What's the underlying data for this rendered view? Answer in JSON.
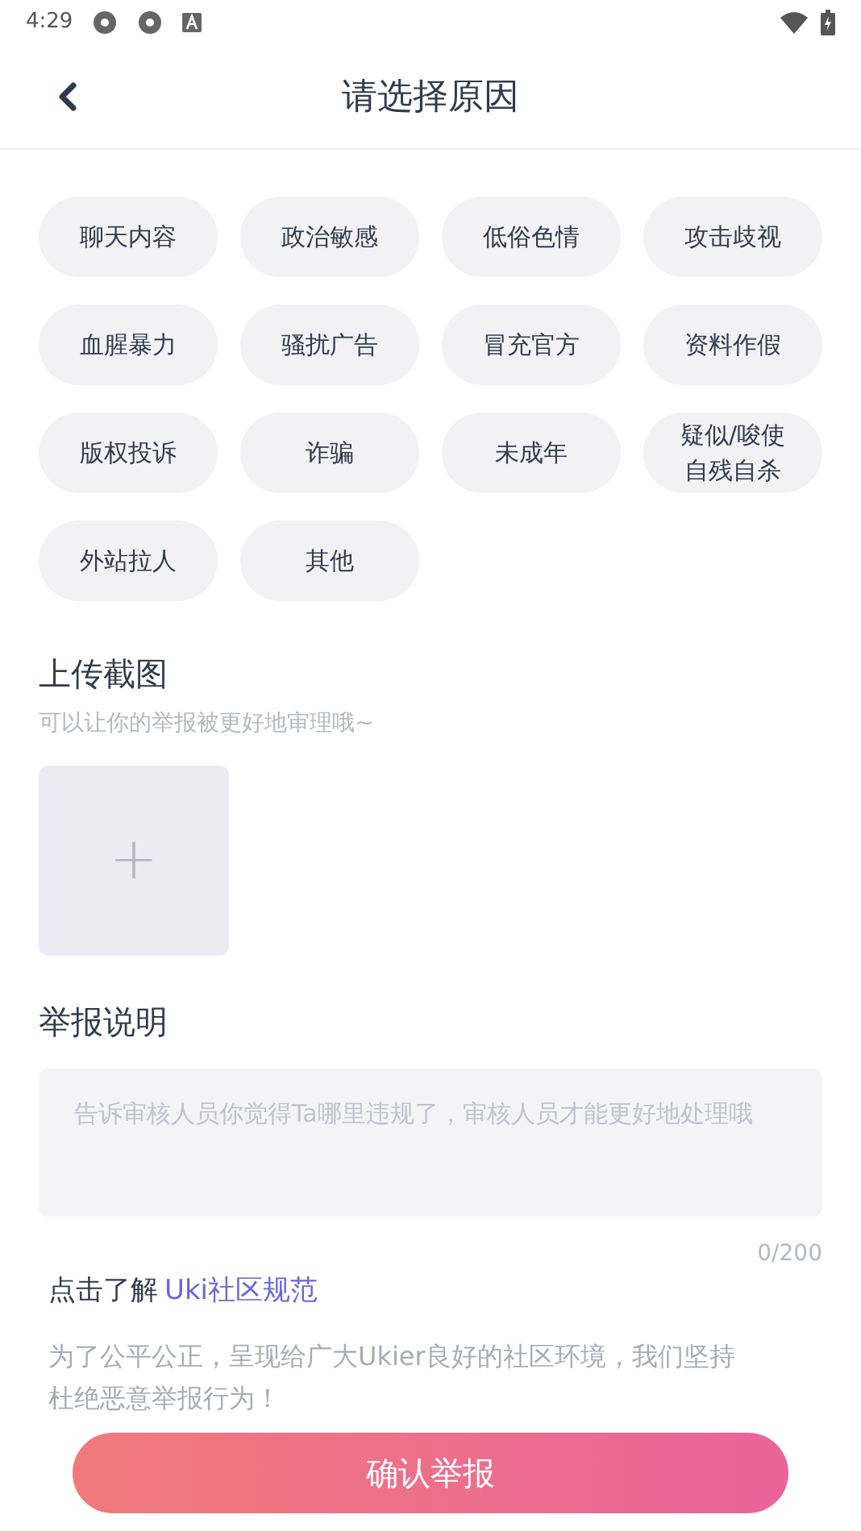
{
  "status_bar": {
    "time": "4:29"
  },
  "header": {
    "title": "请选择原因"
  },
  "reasons": [
    {
      "label": "聊天内容",
      "selected": false
    },
    {
      "label": "政治敏感",
      "selected": false
    },
    {
      "label": "低俗色情",
      "selected": false
    },
    {
      "label": "攻击歧视",
      "selected": false
    },
    {
      "label": "血腥暴力",
      "selected": false
    },
    {
      "label": "骚扰广告",
      "selected": false
    },
    {
      "label": "冒充官方",
      "selected": false
    },
    {
      "label": "资料作假",
      "selected": false
    },
    {
      "label": "版权投诉",
      "selected": false
    },
    {
      "label": "诈骗",
      "selected": false
    },
    {
      "label": "未成年",
      "selected": false
    },
    {
      "label": "疑似/唆使自残自杀",
      "selected": false
    },
    {
      "label": "外站拉人",
      "selected": false
    },
    {
      "label": "其他",
      "selected": false
    }
  ],
  "upload": {
    "title": "上传截图",
    "hint": "可以让你的举报被更好地审理哦~",
    "add_button": "+"
  },
  "description": {
    "title": "举报说明",
    "placeholder": "告诉审核人员你觉得Ta哪里违规了，审核人员才能更好地处理哦",
    "counter": "0/200"
  },
  "guideline": {
    "prefix": "点击了解",
    "link": "Uki社区规范"
  },
  "notice": "为了公平公正，呈现给广大Ukier良好的社区环境，我们坚持杜绝恶意举报行为！",
  "submit_button": "确认举报"
}
